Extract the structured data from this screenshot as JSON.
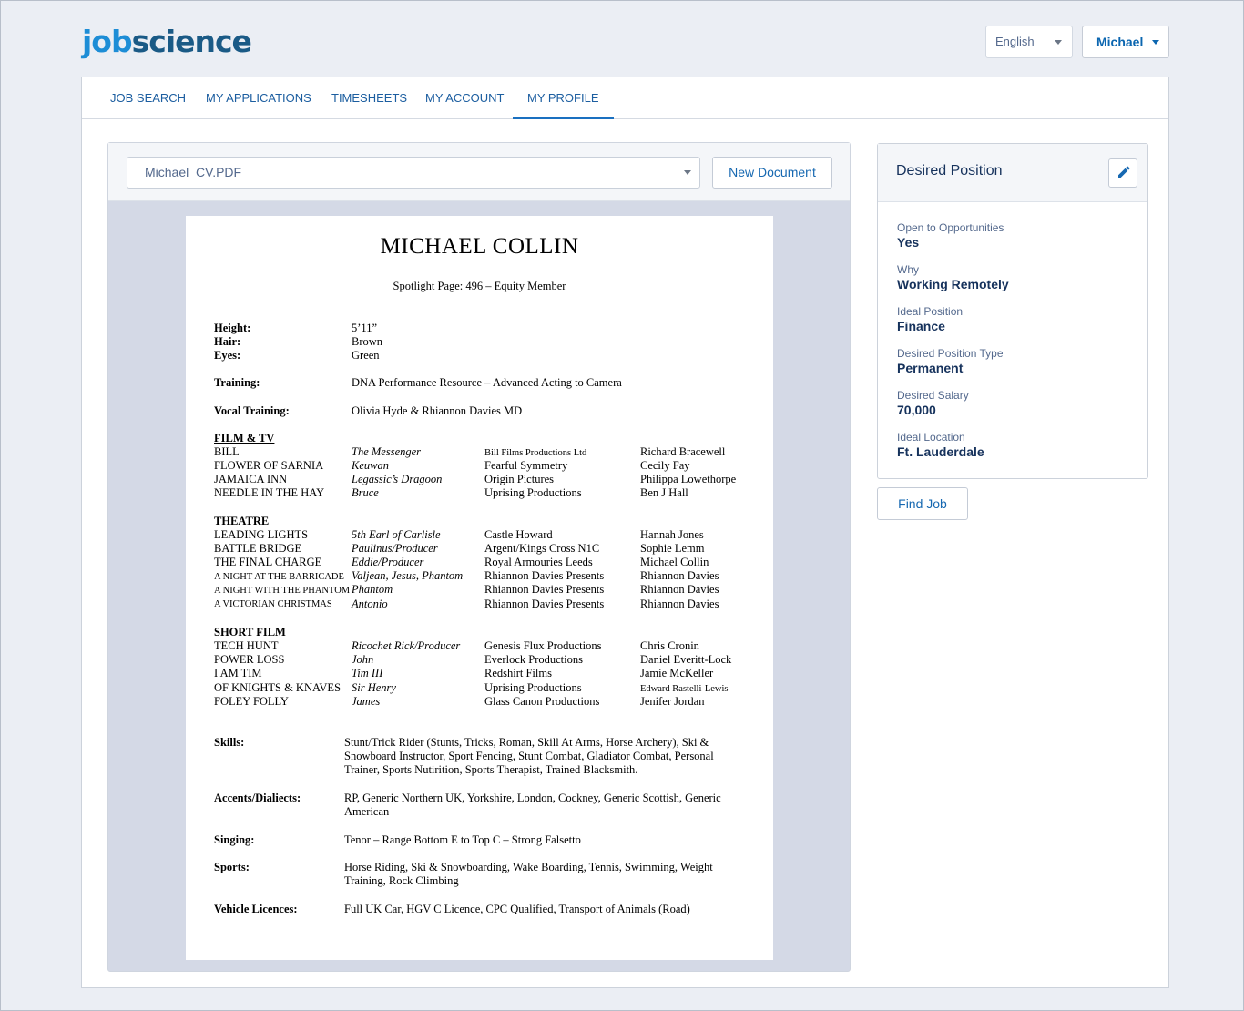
{
  "brand": {
    "logo_part1": "job",
    "logo_part2": "science"
  },
  "header": {
    "language": "English",
    "user": "Michael"
  },
  "nav": {
    "tabs": [
      {
        "label": "Job Search"
      },
      {
        "label": "My Applications"
      },
      {
        "label": "Timesheets"
      },
      {
        "label": "My Account"
      },
      {
        "label": "My Profile",
        "active": true
      }
    ]
  },
  "document": {
    "selected_file": "Michael_CV.PDF",
    "new_document_label": "New Document"
  },
  "cv": {
    "name": "MICHAEL COLLIN",
    "subtitle": "Spotlight Page: 496 – Equity Member",
    "stats": [
      {
        "label": "Height:",
        "value": "5’11”"
      },
      {
        "label": "Hair:",
        "value": "Brown"
      },
      {
        "label": "Eyes:",
        "value": "Green"
      }
    ],
    "training_label": "Training:",
    "training_value": "DNA Performance Resource – Advanced Acting to Camera",
    "vocal_label": "Vocal Training:",
    "vocal_value": "Olivia Hyde & Rhiannon Davies MD",
    "film_tv": {
      "heading": "FILM & TV",
      "rows": [
        [
          "BILL",
          "The Messenger",
          "Bill Films Productions Ltd",
          "Richard Bracewell"
        ],
        [
          "FLOWER OF SARNIA",
          "Keuwan",
          "Fearful Symmetry",
          "Cecily Fay"
        ],
        [
          "JAMAICA INN",
          "Legassic’s Dragoon",
          "Origin Pictures",
          "Philippa Lowethorpe"
        ],
        [
          "NEEDLE IN THE HAY",
          "Bruce",
          "Uprising Productions",
          "Ben J Hall"
        ]
      ]
    },
    "theatre": {
      "heading": "THEATRE",
      "rows": [
        [
          "LEADING LIGHTS",
          "5th Earl of Carlisle",
          "Castle Howard",
          "Hannah Jones"
        ],
        [
          "BATTLE BRIDGE",
          "Paulinus/Producer",
          "Argent/Kings Cross N1C",
          "Sophie Lemm"
        ],
        [
          "THE FINAL CHARGE",
          "Eddie/Producer",
          "Royal Armouries Leeds",
          "Michael Collin"
        ],
        [
          "A NIGHT AT THE BARRICADE",
          "Valjean, Jesus, Phantom",
          "Rhiannon Davies Presents",
          "Rhiannon Davies"
        ],
        [
          "A NIGHT WITH THE PHANTOM",
          "Phantom",
          "Rhiannon Davies Presents",
          "Rhiannon Davies"
        ],
        [
          "A VICTORIAN CHRISTMAS",
          "Antonio",
          "Rhiannon Davies Presents",
          "Rhiannon Davies"
        ]
      ]
    },
    "short_film": {
      "heading": "SHORT FILM",
      "rows": [
        [
          "TECH HUNT",
          "Ricochet Rick/Producer",
          "Genesis Flux Productions",
          "Chris Cronin"
        ],
        [
          "POWER LOSS",
          "John",
          "Everlock Productions",
          "Daniel Everitt-Lock"
        ],
        [
          "I AM TIM",
          "Tim III",
          "Redshirt Films",
          "Jamie McKeller"
        ],
        [
          "OF KNIGHTS & KNAVES",
          "Sir Henry",
          "Uprising Productions",
          "Edward Rastelli-Lewis"
        ],
        [
          "FOLEY FOLLY",
          "James",
          "Glass Canon Productions",
          "Jenifer Jordan"
        ]
      ]
    },
    "skills_label": "Skills:",
    "skills_value": "Stunt/Trick Rider (Stunts, Tricks, Roman, Skill At Arms, Horse Archery), Ski & Snowboard Instructor, Sport Fencing, Stunt Combat, Gladiator Combat, Personal Trainer, Sports Nutirition, Sports Therapist, Trained Blacksmith.",
    "accents_label": "Accents/Dialiects:",
    "accents_value": "RP, Generic Northern UK, Yorkshire, London, Cockney, Generic Scottish, Generic American",
    "singing_label": "Singing:",
    "singing_value": "Tenor – Range Bottom E to Top C – Strong Falsetto",
    "sports_label": "Sports:",
    "sports_value": "Horse Riding, Ski & Snowboarding, Wake Boarding, Tennis, Swimming, Weight Training, Rock Climbing",
    "vehicle_label": "Vehicle Licences:",
    "vehicle_value": "Full UK Car, HGV C Licence, CPC Qualified, Transport of Animals (Road)"
  },
  "desired_position": {
    "title": "Desired Position",
    "fields": [
      {
        "label": "Open to Opportunities",
        "value": "Yes"
      },
      {
        "label": "Why",
        "value": "Working Remotely"
      },
      {
        "label": "Ideal Position",
        "value": "Finance"
      },
      {
        "label": "Desired Position Type",
        "value": "Permanent"
      },
      {
        "label": "Desired Salary",
        "value": "70,000"
      },
      {
        "label": "Ideal Location",
        "value": "Ft. Lauderdale"
      }
    ],
    "find_job_label": "Find Job"
  }
}
